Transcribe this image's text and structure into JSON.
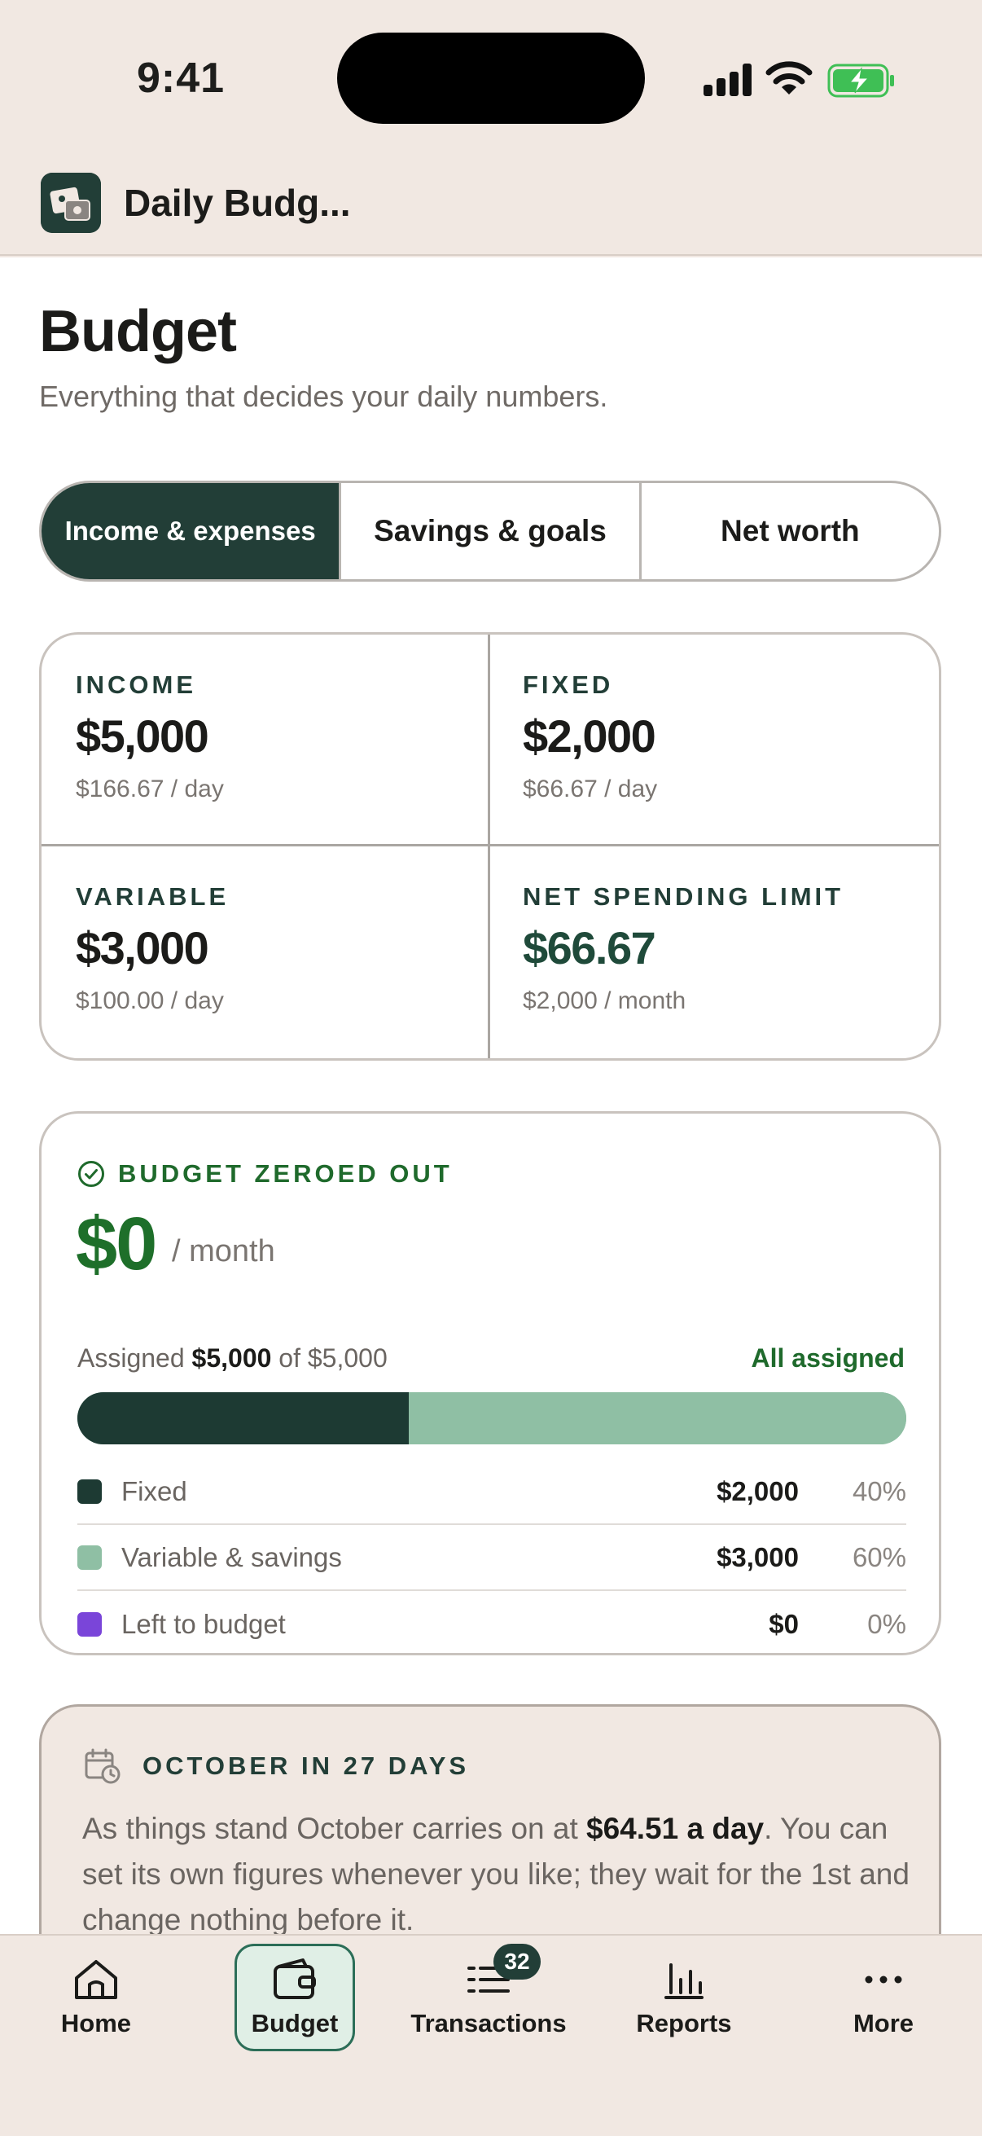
{
  "status_bar": {
    "time": "9:41"
  },
  "app": {
    "title": "Daily Budg..."
  },
  "page": {
    "title": "Budget",
    "subtitle": "Everything that decides your daily numbers."
  },
  "tabs_segment": [
    {
      "label": "Income & expenses",
      "active": true
    },
    {
      "label": "Savings & goals",
      "active": false
    },
    {
      "label": "Net worth",
      "active": false
    }
  ],
  "stats": [
    {
      "label": "INCOME",
      "value": "$5,000",
      "sub": "$166.67 / day"
    },
    {
      "label": "FIXED",
      "value": "$2,000",
      "sub": "$66.67 / day"
    },
    {
      "label": "VARIABLE",
      "value": "$3,000",
      "sub": "$100.00 / day"
    },
    {
      "label": "NET SPENDING LIMIT",
      "value": "$66.67",
      "sub": "$2,000 / month"
    }
  ],
  "zero_card": {
    "label": "BUDGET ZEROED OUT",
    "amount": "$0",
    "per": "/ month",
    "assigned_prefix": "Assigned",
    "assigned_amount": "$5,000",
    "assigned_suffix": "of $5,000",
    "status": "All assigned",
    "bar": {
      "fixed_fraction": 0.4,
      "variable_fraction": 0.6
    },
    "legend": [
      {
        "name": "Fixed",
        "amount": "$2,000",
        "pct": "40%",
        "color": "#1d3a33"
      },
      {
        "name": "Variable & savings",
        "amount": "$3,000",
        "pct": "60%",
        "color": "#8fbfa4"
      },
      {
        "name": "Left to budget",
        "amount": "$0",
        "pct": "0%",
        "color": "#7a45d9"
      }
    ]
  },
  "october_card": {
    "label": "OCTOBER IN 27 DAYS",
    "text_before": "As things stand October carries on at",
    "text_bold": "$64.51 a day",
    "text_after": ". You can set its own figures whenever you like; they wait for the 1st and change nothing before it."
  },
  "tab_bar": {
    "items": [
      {
        "label": "Home",
        "icon": "home-icon"
      },
      {
        "label": "Budget",
        "icon": "wallet-icon",
        "active": true
      },
      {
        "label": "Transactions",
        "icon": "list-icon"
      },
      {
        "label": "Reports",
        "icon": "bar-chart-icon"
      },
      {
        "label": "More",
        "icon": "more-icon"
      }
    ],
    "transactions_badge": "32"
  },
  "colors": {
    "accent_dark": "#223e37",
    "accent_green": "#1f6a2c",
    "light_green": "#8fbfa4",
    "purple": "#7a45d9",
    "background": "#f1e8e2"
  }
}
